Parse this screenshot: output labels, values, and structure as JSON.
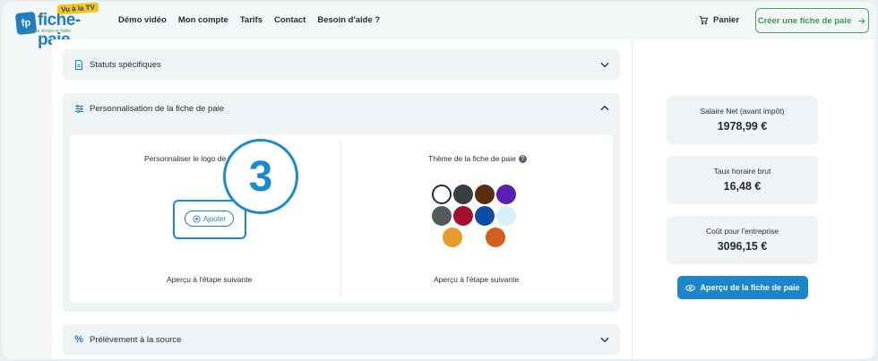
{
  "header": {
    "logo": {
      "initials": "fp",
      "name": "fiche-paie",
      "badge": "Vu à la TV",
      "tagline": "La paie simple et fiable"
    },
    "nav": [
      "Démo vidéo",
      "Mon compte",
      "Tarifs",
      "Contact",
      "Besoin d'aide ?"
    ],
    "cart_label": "Panier",
    "cta_label": "Créer une fiche de paie"
  },
  "sections": {
    "statuts": {
      "title": "Statuts spécifiques"
    },
    "personnalisation": {
      "title": "Personnalisation de la fiche de paie",
      "logo_col": {
        "title": "Personnaliser le logo de l'",
        "add_label": "Ajouter",
        "preview": "Aperçu à l'étape suivante"
      },
      "theme_col": {
        "title": "Thème de la fiche de paie",
        "help": "?",
        "preview": "Aperçu à l'étape suivante",
        "colors": [
          "#ffffff",
          "#3a3d40",
          "#5a2c10",
          "#5b1fb0",
          "#55595c",
          "#a3112e",
          "#0b4ea2",
          "#d6f1fa",
          "#e89a2a",
          "#d45f1d"
        ]
      }
    },
    "prelevement": {
      "title": "Prélèvement à la source"
    }
  },
  "step": {
    "number": "3"
  },
  "summary": {
    "net": {
      "label": "Salaire Net (avant impôt)",
      "value": "1978,99 €"
    },
    "taux": {
      "label": "Taux horaire brut",
      "value": "16,48 €"
    },
    "cout": {
      "label": "Coût pour l'entreprise",
      "value": "3096,15 €"
    },
    "preview_button": "Aperçu de la fiche de paie"
  },
  "accent": "#1d86c9",
  "brand_green": "#4aa35d"
}
